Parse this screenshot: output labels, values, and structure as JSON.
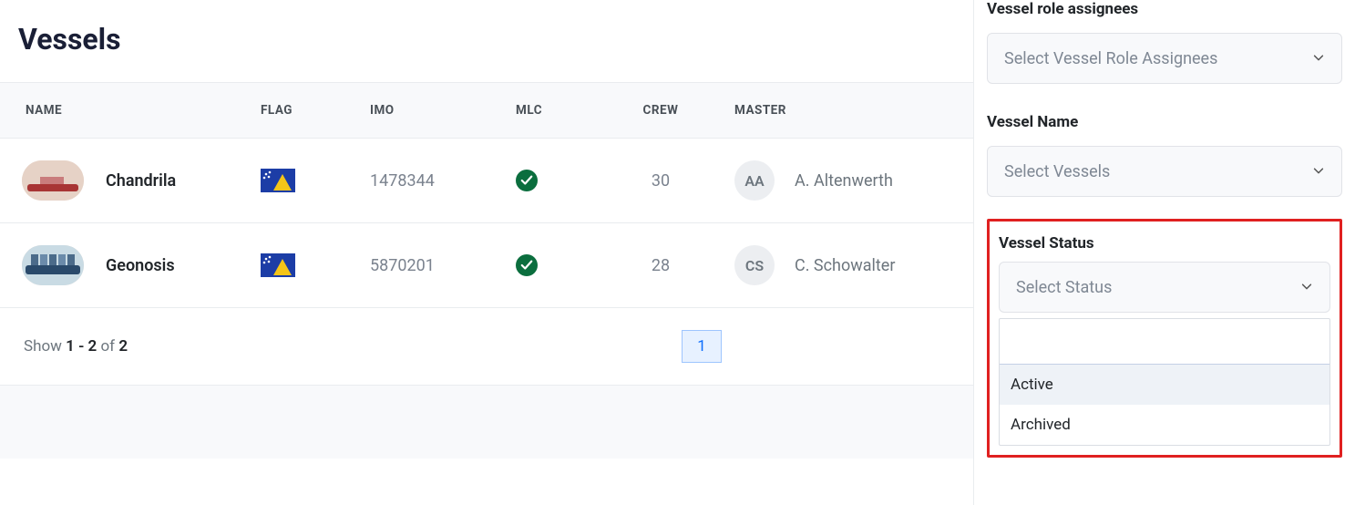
{
  "page": {
    "title": "Vessels"
  },
  "table": {
    "headers": {
      "name": "NAME",
      "flag": "FLAG",
      "imo": "IMO",
      "mlc": "MLC",
      "crew": "CREW",
      "master": "MASTER"
    },
    "rows": [
      {
        "name": "Chandrila",
        "imo": "1478344",
        "mlc": true,
        "crew": "30",
        "master": {
          "initials": "AA",
          "name": "A. Altenwerth"
        }
      },
      {
        "name": "Geonosis",
        "imo": "5870201",
        "mlc": true,
        "crew": "28",
        "master": {
          "initials": "CS",
          "name": "C. Schowalter"
        }
      }
    ]
  },
  "pagination": {
    "show": "Show",
    "from": "1",
    "to": "2",
    "of_word": "of",
    "total": "2",
    "current_page": "1"
  },
  "filters": {
    "role_assignees": {
      "label": "Vessel role assignees",
      "placeholder": "Select Vessel Role Assignees"
    },
    "vessel_name": {
      "label": "Vessel Name",
      "placeholder": "Select Vessels"
    },
    "status": {
      "label": "Vessel Status",
      "placeholder": "Select Status",
      "options": [
        "Active",
        "Archived"
      ]
    }
  }
}
